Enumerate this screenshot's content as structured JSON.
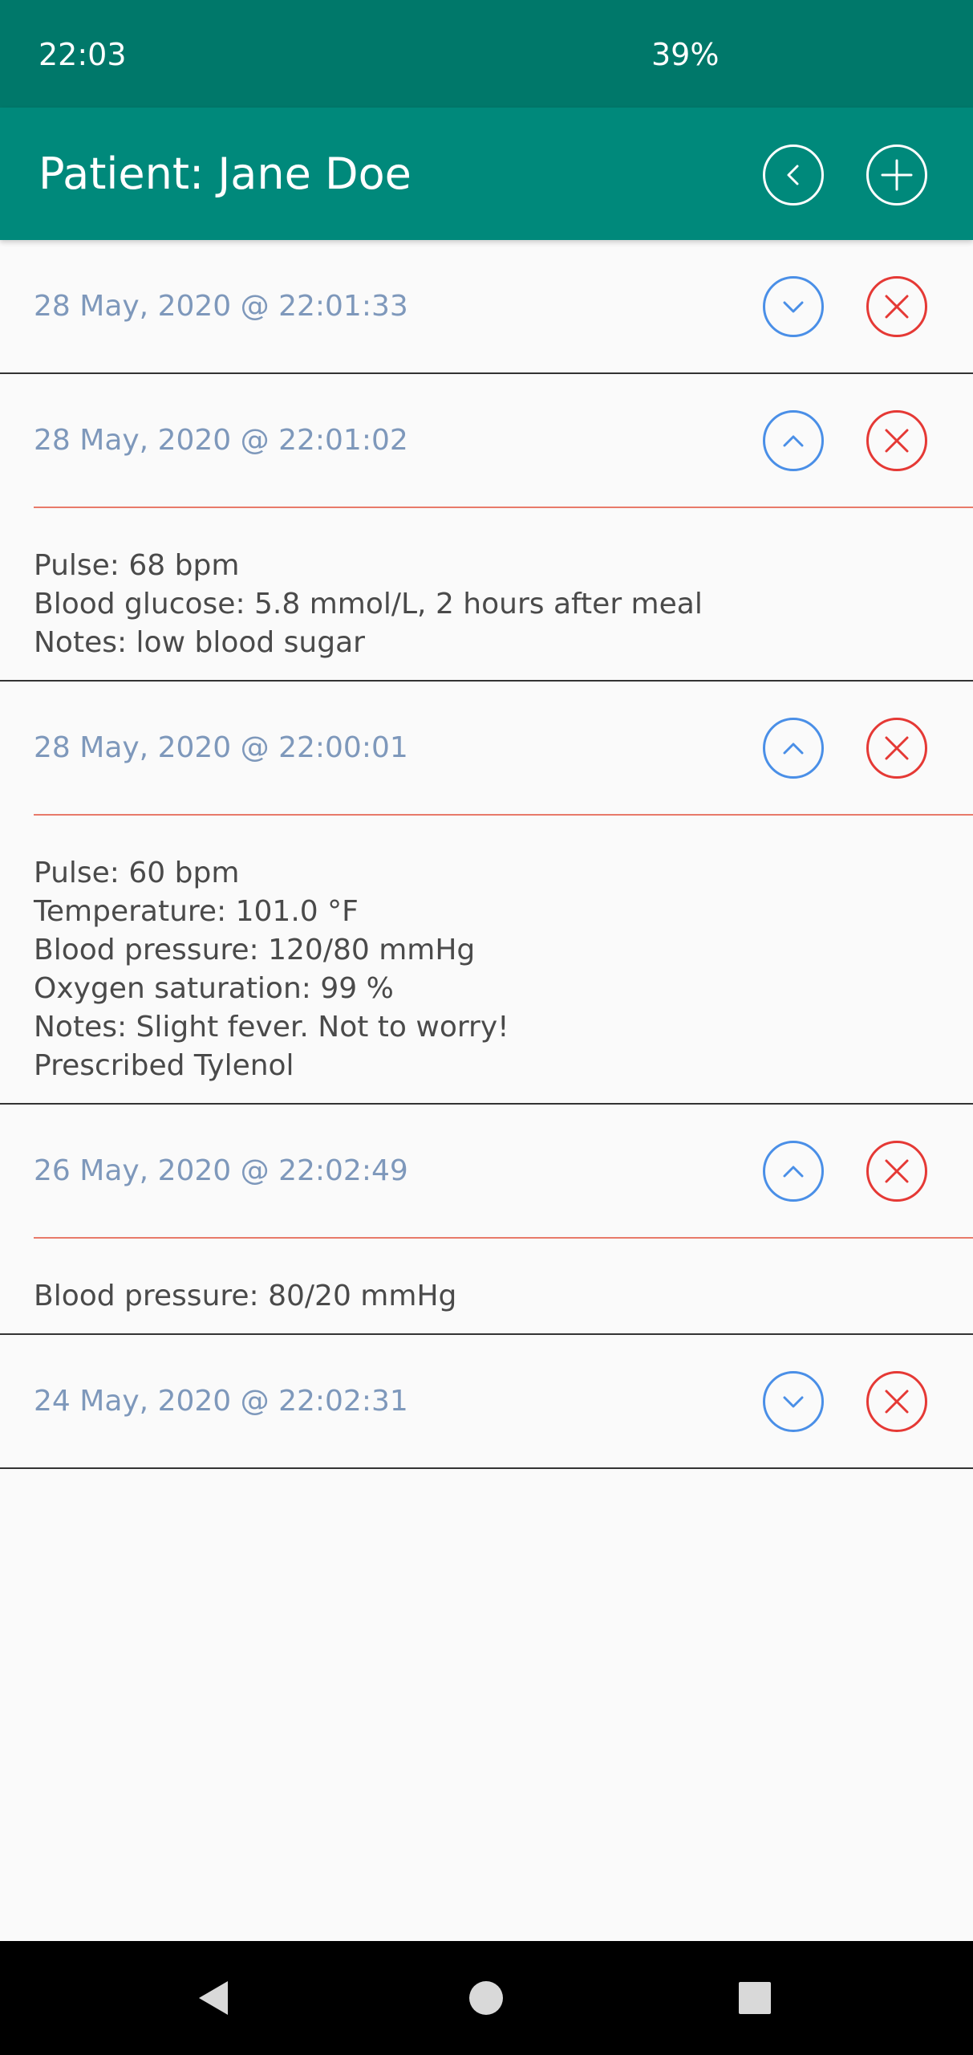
{
  "status_bar": {
    "time": "22:03",
    "battery": "39%"
  },
  "app_bar": {
    "title": "Patient: Jane Doe",
    "back_icon": "chevron-left-circle-icon",
    "add_icon": "plus-circle-icon"
  },
  "colors": {
    "status_bar": "#00786a",
    "app_bar": "#00897b",
    "date_text": "#7e98bb",
    "toggle_blue": "#4a8fe7",
    "delete_red": "#e53935",
    "divider_red": "#e87a6a",
    "body_text": "#4a4a4a",
    "background": "#fafafa"
  },
  "records": [
    {
      "date": "28 May, 2020 @ 22:01:33",
      "expanded": false,
      "details": []
    },
    {
      "date": "28 May, 2020 @ 22:01:02",
      "expanded": true,
      "details": [
        "Pulse: 68 bpm",
        "Blood glucose: 5.8 mmol/L, 2 hours after meal",
        "Notes: low blood sugar"
      ]
    },
    {
      "date": "28 May, 2020 @ 22:00:01",
      "expanded": true,
      "details": [
        "Pulse: 60 bpm",
        "Temperature: 101.0 °F",
        "Blood pressure: 120/80 mmHg",
        "Oxygen saturation: 99 %",
        "Notes: Slight fever. Not to worry!",
        "Prescribed Tylenol"
      ]
    },
    {
      "date": "26 May, 2020 @ 22:02:49",
      "expanded": true,
      "details": [
        "Blood pressure: 80/20 mmHg"
      ]
    },
    {
      "date": "24 May, 2020 @ 22:02:31",
      "expanded": false,
      "details": []
    }
  ],
  "nav_bar": {
    "back_icon": "triangle-back-icon",
    "home_icon": "circle-home-icon",
    "recents_icon": "square-recents-icon"
  }
}
